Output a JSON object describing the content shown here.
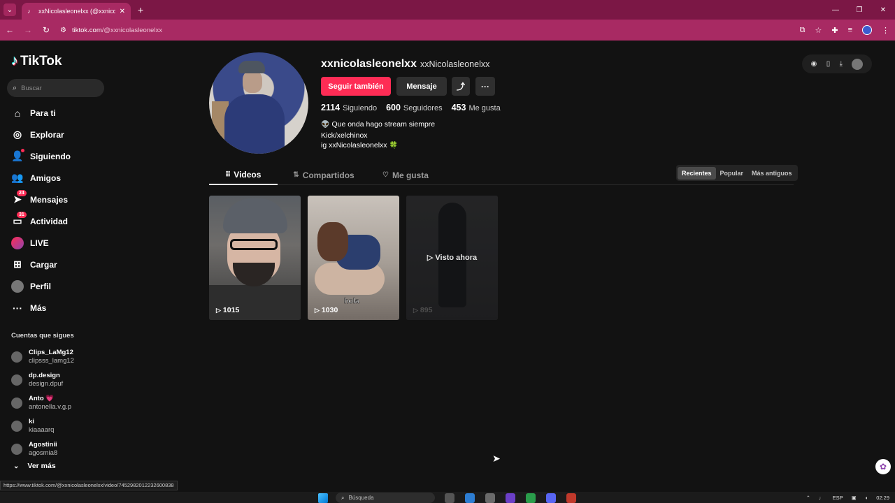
{
  "browser": {
    "tab_title": "xxNicolasleonelxx (@xxnicolasle",
    "url_host": "tiktok.com",
    "url_path": "/@xxnicolasleonelxx"
  },
  "sidebar": {
    "logo": "TikTok",
    "search_placeholder": "Buscar",
    "items": [
      {
        "label": "Para ti"
      },
      {
        "label": "Explorar"
      },
      {
        "label": "Siguiendo"
      },
      {
        "label": "Amigos"
      },
      {
        "label": "Mensajes",
        "badge": "24"
      },
      {
        "label": "Actividad",
        "badge": "31"
      },
      {
        "label": "LIVE"
      },
      {
        "label": "Cargar"
      },
      {
        "label": "Perfil"
      },
      {
        "label": "Más"
      }
    ],
    "following_title": "Cuentas que sigues",
    "following": [
      {
        "name": "Clips_LaMg12",
        "handle": "clipsss_lamg12"
      },
      {
        "name": "dp.design",
        "handle": "design.dpuf"
      },
      {
        "name": "Anto 💗",
        "handle": "antonella.v.g.p"
      },
      {
        "name": "ki",
        "handle": "kiaaaarq"
      },
      {
        "name": "Agostinii",
        "handle": "agosmia8"
      }
    ],
    "see_more": "Ver más"
  },
  "profile": {
    "username": "xxnicolasleonelxx",
    "nickname": "xxNicolasleonelxx",
    "follow_button": "Seguir también",
    "message_button": "Mensaje",
    "stats": {
      "following_num": "2114",
      "following_label": "Siguiendo",
      "followers_num": "600",
      "followers_label": "Seguidores",
      "likes_num": "453",
      "likes_label": "Me gusta"
    },
    "bio": {
      "line1_emoji": "👽",
      "line1": "Que onda hago stream siempre",
      "line2": "Kick/xelchinox",
      "line3": "ig xxNicolasleonelxx",
      "line3_emoji": "🍀"
    }
  },
  "tabs": {
    "videos": "Videos",
    "shared": "Compartidos",
    "liked": "Me gusta"
  },
  "sort": {
    "recent": "Recientes",
    "popular": "Popular",
    "oldest": "Más antiguos"
  },
  "videos": [
    {
      "views": "1015"
    },
    {
      "views": "1030",
      "caption": "hola"
    },
    {
      "views": "895",
      "overlay": "Visto ahora"
    }
  ],
  "status_url": "https://www.tiktok.com/@xxnicolasleonelxx/video/7452982012232600838",
  "taskbar": {
    "search": "Búsqueda",
    "lang": "ESP",
    "time": "02:29"
  }
}
